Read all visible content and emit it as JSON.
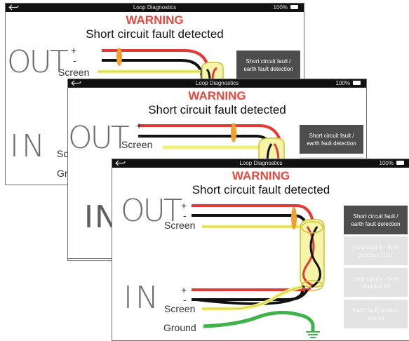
{
  "app": {
    "title": "Loop Diagnostics",
    "battery": "100%",
    "warning": "WARNING",
    "message": "Short circuit fault detected"
  },
  "labels": {
    "out": "OUT",
    "in": "IN",
    "plus": "+",
    "minus": "-",
    "screen": "Screen",
    "ground": "Ground",
    "sc_partial": "Sc",
    "gr_partial": "Gr"
  },
  "buttons": [
    {
      "label": "Short circuit fault / earth fault detection",
      "state": "active"
    },
    {
      "label": "Loop supply - from direction OUT",
      "state": "disabled"
    },
    {
      "label": "Loop supply - from direction IN",
      "state": "disabled"
    },
    {
      "label": "Earth fault location search",
      "state": "disabled"
    }
  ],
  "colors": {
    "warning": "#e8473c",
    "wire_positive": "#e53935",
    "wire_negative": "#111111",
    "wire_screen": "#f0ef7a",
    "wire_ground": "#3fb24a",
    "fault_marker": "#f0a22e",
    "button_active": "#4d4d4d",
    "button_disabled": "#e3e3e3"
  }
}
